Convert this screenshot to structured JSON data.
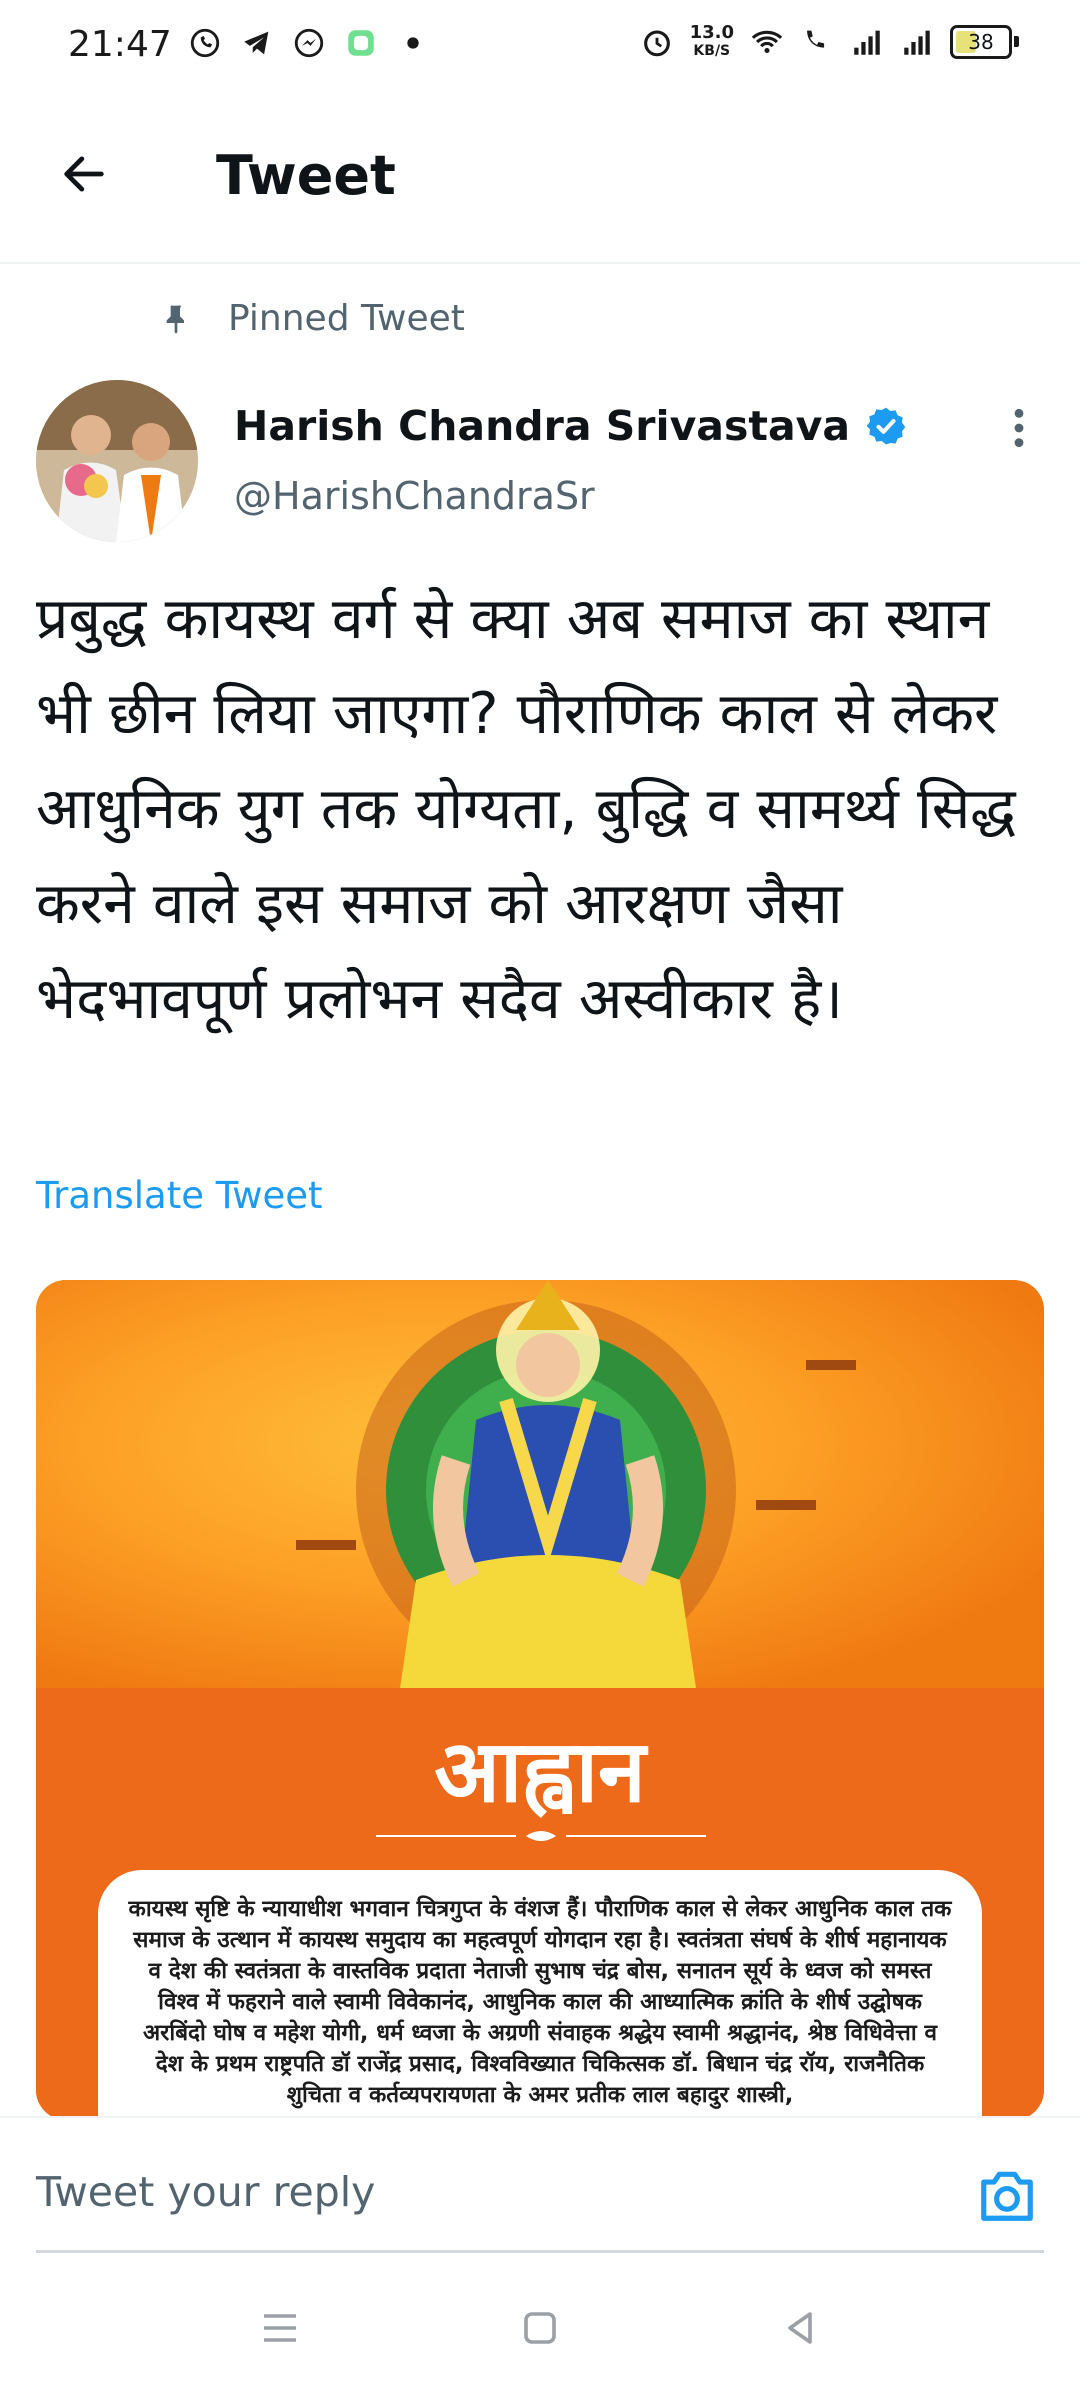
{
  "status_bar": {
    "time": "21:47",
    "net_speed_value": "13.0",
    "net_speed_unit": "KB/S",
    "battery": "38"
  },
  "header": {
    "title": "Tweet"
  },
  "tweet": {
    "pinned_label": "Pinned Tweet",
    "author_name": "Harish Chandra Srivastava",
    "handle": "@HarishChandraSr",
    "text": "प्रबुद्ध कायस्थ वर्ग से क्या अब समाज का स्थान भी छीन लिया जाएगा? पौराणिक काल से लेकर आधुनिक युग तक योग्यता, बुद्धि व सामर्थ्य सिद्ध करने वाले इस समाज को आरक्षण जैसा भेदभावपूर्ण प्रलोभन सदैव अस्वीकार है।",
    "translate_label": "Translate Tweet",
    "media": {
      "heading": "आह्वान",
      "body": "कायस्थ सृष्टि के न्यायाधीश भगवान चित्रगुप्त के वंशज हैं। पौराणिक काल से लेकर आधुनिक काल तक समाज के उत्थान में कायस्थ समुदाय का महत्वपूर्ण योगदान रहा है। स्वतंत्रता संघर्ष के शीर्ष महानायक व देश की स्वतंत्रता के वास्तविक प्रदाता नेताजी सुभाष चंद्र बोस, सनातन सूर्य के ध्वज को समस्त विश्व में फहराने वाले स्वामी विवेकानंद, आधुनिक काल की आध्यात्मिक क्रांति के शीर्ष उद्घोषक अरबिंदो घोष व महेश योगी, धर्म ध्वजा के अग्रणी संवाहक श्रद्धेय स्वामी श्रद्धानंद, श्रेष्ठ विधिवेत्ता व देश के प्रथम राष्ट्रपति डॉ राजेंद्र प्रसाद, विश्वविख्यात चिकित्सक डॉ. बिधान चंद्र रॉय, राजनैतिक शुचिता व कर्तव्यपरायणता के अमर प्रतीक लाल बहादुर शास्त्री,"
    }
  },
  "reply": {
    "placeholder": "Tweet your reply"
  },
  "colors": {
    "accent": "#1d9bf0",
    "media_orange": "#ed6a1a"
  }
}
